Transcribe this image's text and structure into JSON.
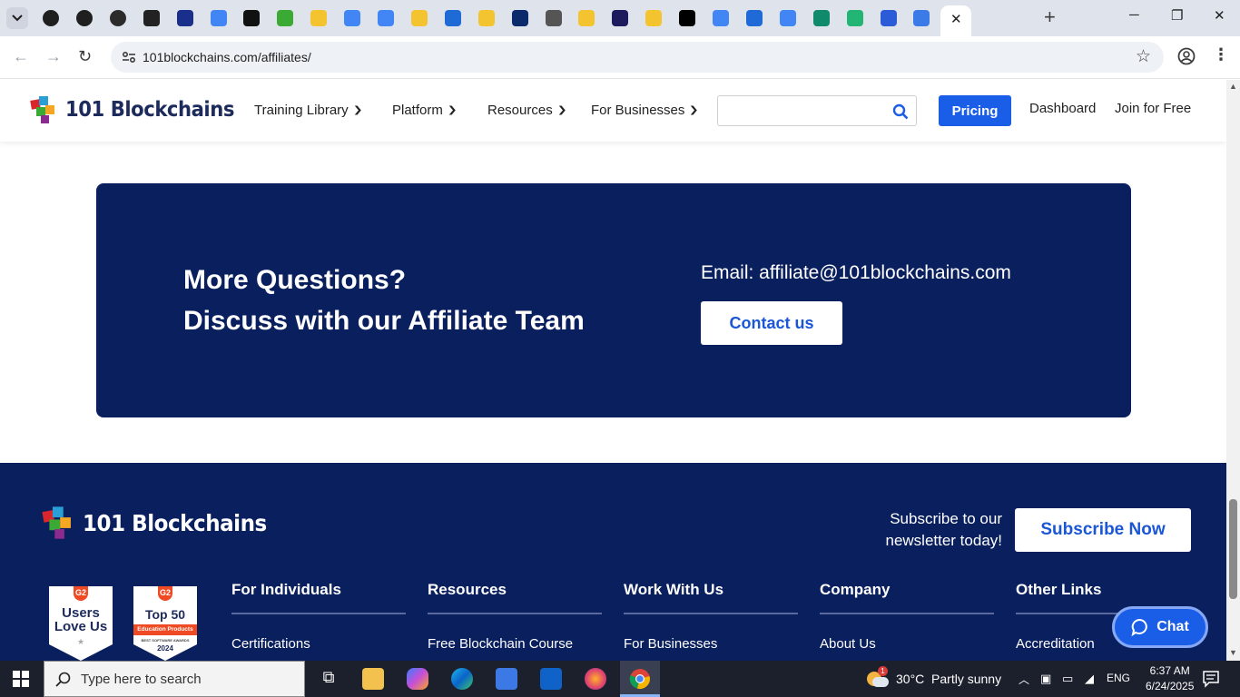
{
  "browser": {
    "url": "101blockchains.com/affiliates/",
    "tab_count_visible": 29
  },
  "site": {
    "logo_text": "101 Blockchains",
    "nav": [
      {
        "label": "Training Library"
      },
      {
        "label": "Platform"
      },
      {
        "label": "Resources"
      },
      {
        "label": "For Businesses"
      }
    ],
    "search_placeholder": "",
    "pricing_label": "Pricing",
    "dashboard_label": "Dashboard",
    "join_label": "Join for Free"
  },
  "cta": {
    "line1": "More Questions?",
    "line2": "Discuss with our Affiliate Team",
    "email": "Email: affiliate@101blockchains.com",
    "button": "Contact us"
  },
  "footer": {
    "logo_text": "101 Blockchains",
    "subscribe_text": "Subscribe to our newsletter today!",
    "subscribe_button": "Subscribe Now",
    "badge1": {
      "g2": "G2",
      "line1": "Users",
      "line2": "Love Us"
    },
    "badge2": {
      "g2": "G2",
      "line1": "Top 50",
      "ribbon": "Education Products",
      "small": "BEST SOFTWARE AWARDS",
      "year": "2024"
    },
    "columns": [
      {
        "heading": "For Individuals",
        "link": "Certifications"
      },
      {
        "heading": "Resources",
        "link": "Free Blockchain Course"
      },
      {
        "heading": "Work With Us",
        "link": "For Businesses"
      },
      {
        "heading": "Company",
        "link": "About Us"
      },
      {
        "heading": "Other Links",
        "link": "Accreditation"
      }
    ]
  },
  "chat": {
    "label": "Chat"
  },
  "taskbar": {
    "search_placeholder": "Type here to search",
    "weather": "30°C  Partly sunny",
    "weather_alert": "1",
    "language": "ENG",
    "time": "6:37 AM",
    "date": "6/24/2025"
  },
  "colors": {
    "navy": "#0a1f5e",
    "accent_blue": "#1a5ee8"
  }
}
